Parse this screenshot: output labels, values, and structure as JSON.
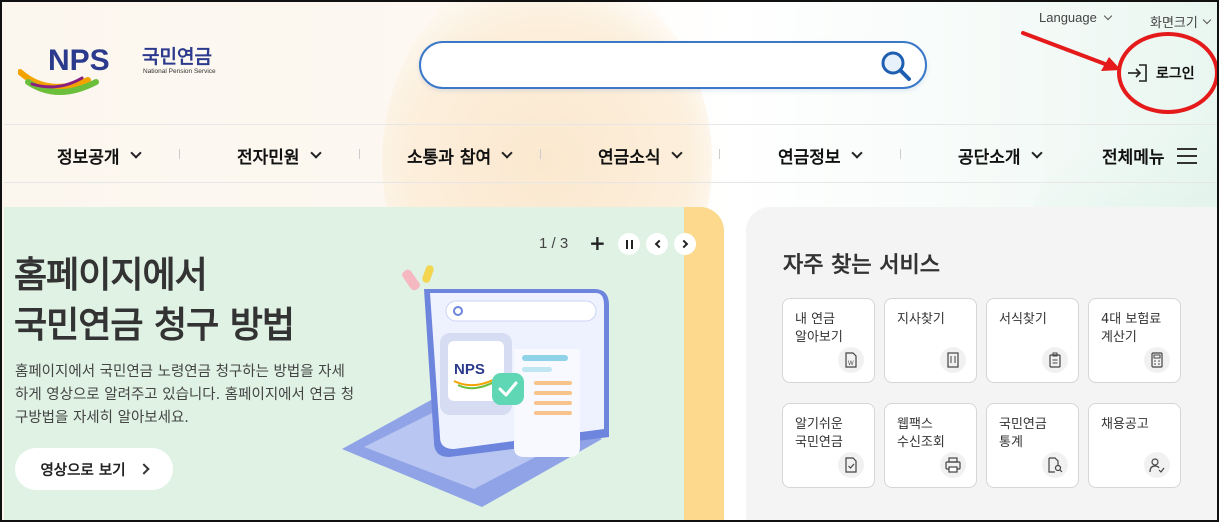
{
  "header": {
    "logo_text": "NPS",
    "logo_kor": "국민연금",
    "logo_eng": "National Pension Service",
    "search_placeholder": "",
    "language_label": "Language",
    "text_size_label": "화면크기",
    "login_label": "로그인"
  },
  "nav": {
    "items": [
      {
        "label": "정보공개"
      },
      {
        "label": "전자민원"
      },
      {
        "label": "소통과 참여"
      },
      {
        "label": "연금소식"
      },
      {
        "label": "연금정보"
      },
      {
        "label": "공단소개"
      }
    ],
    "all_menu_label": "전체메뉴"
  },
  "banner": {
    "title_line1": "홈페이지에서",
    "title_line2": "국민연금 청구 방법",
    "description": "홈페이지에서 국민연금 노령연금 청구하는 방법을 자세하게 영상으로 알려주고 있습니다. 홈페이지에서 연금 청구방법을 자세히 알아보세요.",
    "button_label": "영상으로 보기",
    "pager": "1 / 3",
    "plus": "+",
    "illustration_badge": "NPS"
  },
  "services": {
    "title": "자주 찾는 서비스",
    "items": [
      {
        "label": "내 연금\n알아보기",
        "icon": "document-w-icon"
      },
      {
        "label": "지사찾기",
        "icon": "building-icon"
      },
      {
        "label": "서식찾기",
        "icon": "clipboard-icon"
      },
      {
        "label": "4대 보험료\n계산기",
        "icon": "calculator-icon"
      },
      {
        "label": "알기쉬운\n국민연금",
        "icon": "document-check-icon"
      },
      {
        "label": "웹팩스\n수신조회",
        "icon": "printer-icon"
      },
      {
        "label": "국민연금\n통계",
        "icon": "document-search-icon"
      },
      {
        "label": "채용공고",
        "icon": "person-check-icon"
      }
    ]
  },
  "annotation": {
    "color": "#e51b1b"
  }
}
